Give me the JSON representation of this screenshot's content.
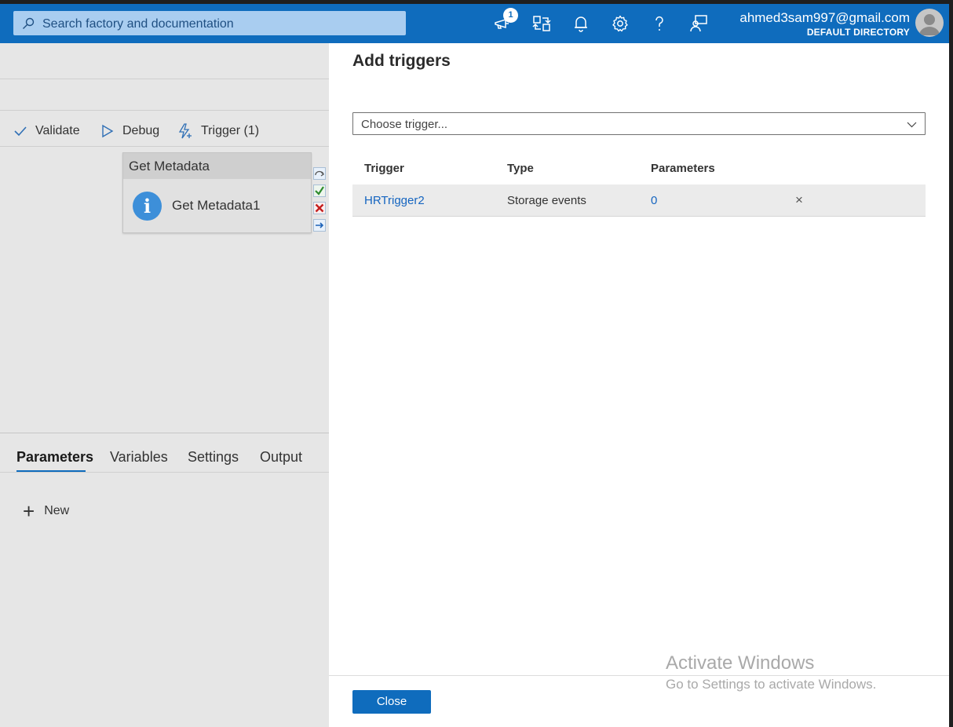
{
  "topbar": {
    "search_placeholder": "Search factory and documentation",
    "notification_count": "1",
    "user_email": "ahmed3sam997@gmail.com",
    "user_directory": "DEFAULT DIRECTORY",
    "icons": [
      "announcement-icon",
      "switch-directory-icon",
      "bell-icon",
      "gear-icon",
      "help-icon",
      "feedback-icon",
      "avatar"
    ]
  },
  "toolbar": {
    "validate": "Validate",
    "debug": "Debug",
    "trigger": "Trigger (1)"
  },
  "activity": {
    "type": "Get Metadata",
    "name": "Get Metadata1"
  },
  "bottom_tabs": {
    "parameters": "Parameters",
    "variables": "Variables",
    "settings": "Settings",
    "output": "Output",
    "new_button": "New"
  },
  "panel": {
    "title": "Add triggers",
    "dropdown_placeholder": "Choose trigger...",
    "columns": [
      "Trigger",
      "Type",
      "Parameters"
    ],
    "rows": [
      {
        "trigger": "HRTrigger2",
        "type": "Storage events",
        "parameters": "0"
      }
    ],
    "close_button": "Close"
  },
  "watermark": {
    "title": "Activate Windows",
    "subtitle": "Go to Settings to activate Windows."
  },
  "colors": {
    "accent": "#0f6cbd",
    "link": "#1565c0"
  }
}
